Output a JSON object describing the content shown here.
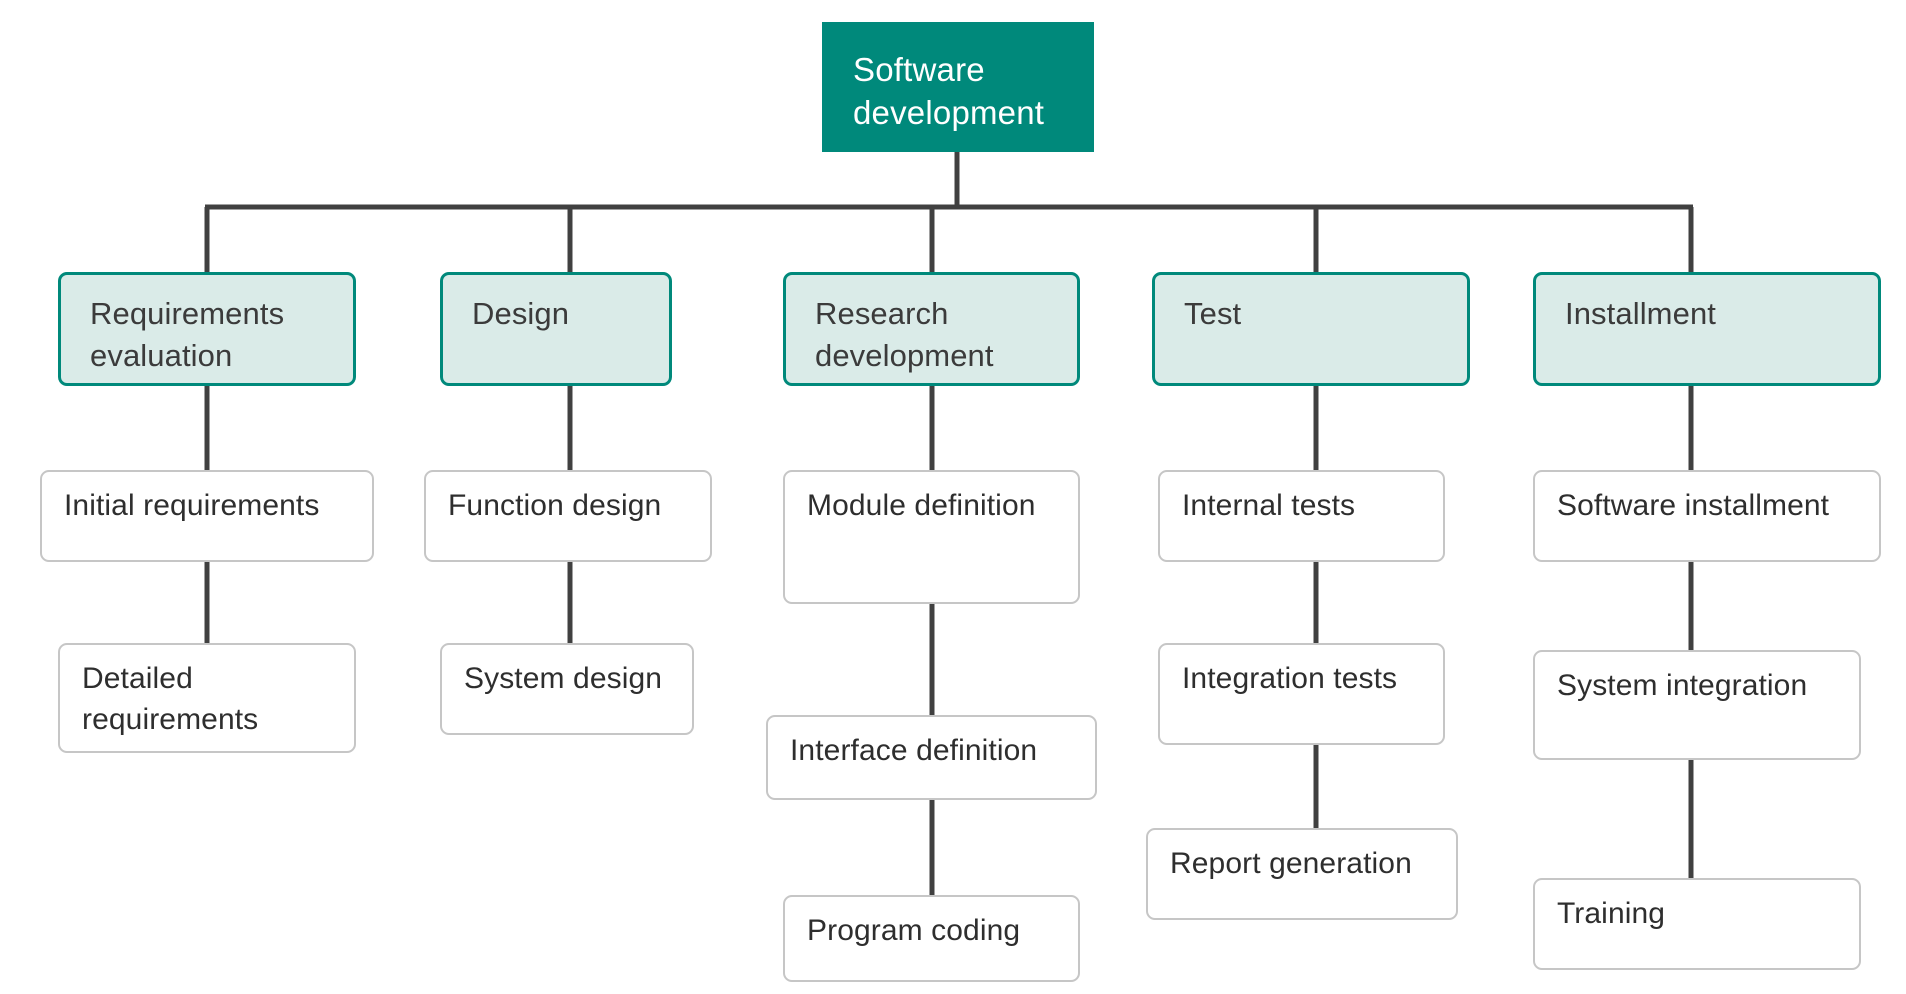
{
  "diagram": {
    "title": "Software development",
    "type": "organizational-tree",
    "colors": {
      "root_fill": "#00897B",
      "root_text": "#FFFFFF",
      "level2_fill": "#DAEBE8",
      "level2_border": "#00897B",
      "level3_fill": "#FFFFFF",
      "level3_border": "#C6C6C6",
      "connector": "#404040",
      "body_text": "#3B3B3B",
      "background": "#FFFFFF"
    },
    "root": {
      "label": "Software development",
      "label_line1": "Software",
      "label_line2": "development"
    },
    "branches": [
      {
        "label": "Requirements evaluation",
        "children": [
          {
            "label": "Initial requirements"
          },
          {
            "label": "Detailed requirements"
          }
        ]
      },
      {
        "label": "Design",
        "children": [
          {
            "label": "Function design"
          },
          {
            "label": "System design"
          }
        ]
      },
      {
        "label": "Research development",
        "children": [
          {
            "label": "Module definition"
          },
          {
            "label": "Interface definition"
          },
          {
            "label": "Program coding"
          }
        ]
      },
      {
        "label": "Test",
        "children": [
          {
            "label": "Internal tests"
          },
          {
            "label": "Integration tests"
          },
          {
            "label": "Report generation"
          }
        ]
      },
      {
        "label": "Installment",
        "children": [
          {
            "label": "Software installment"
          },
          {
            "label": "System integration"
          },
          {
            "label": "Training"
          }
        ]
      }
    ]
  }
}
